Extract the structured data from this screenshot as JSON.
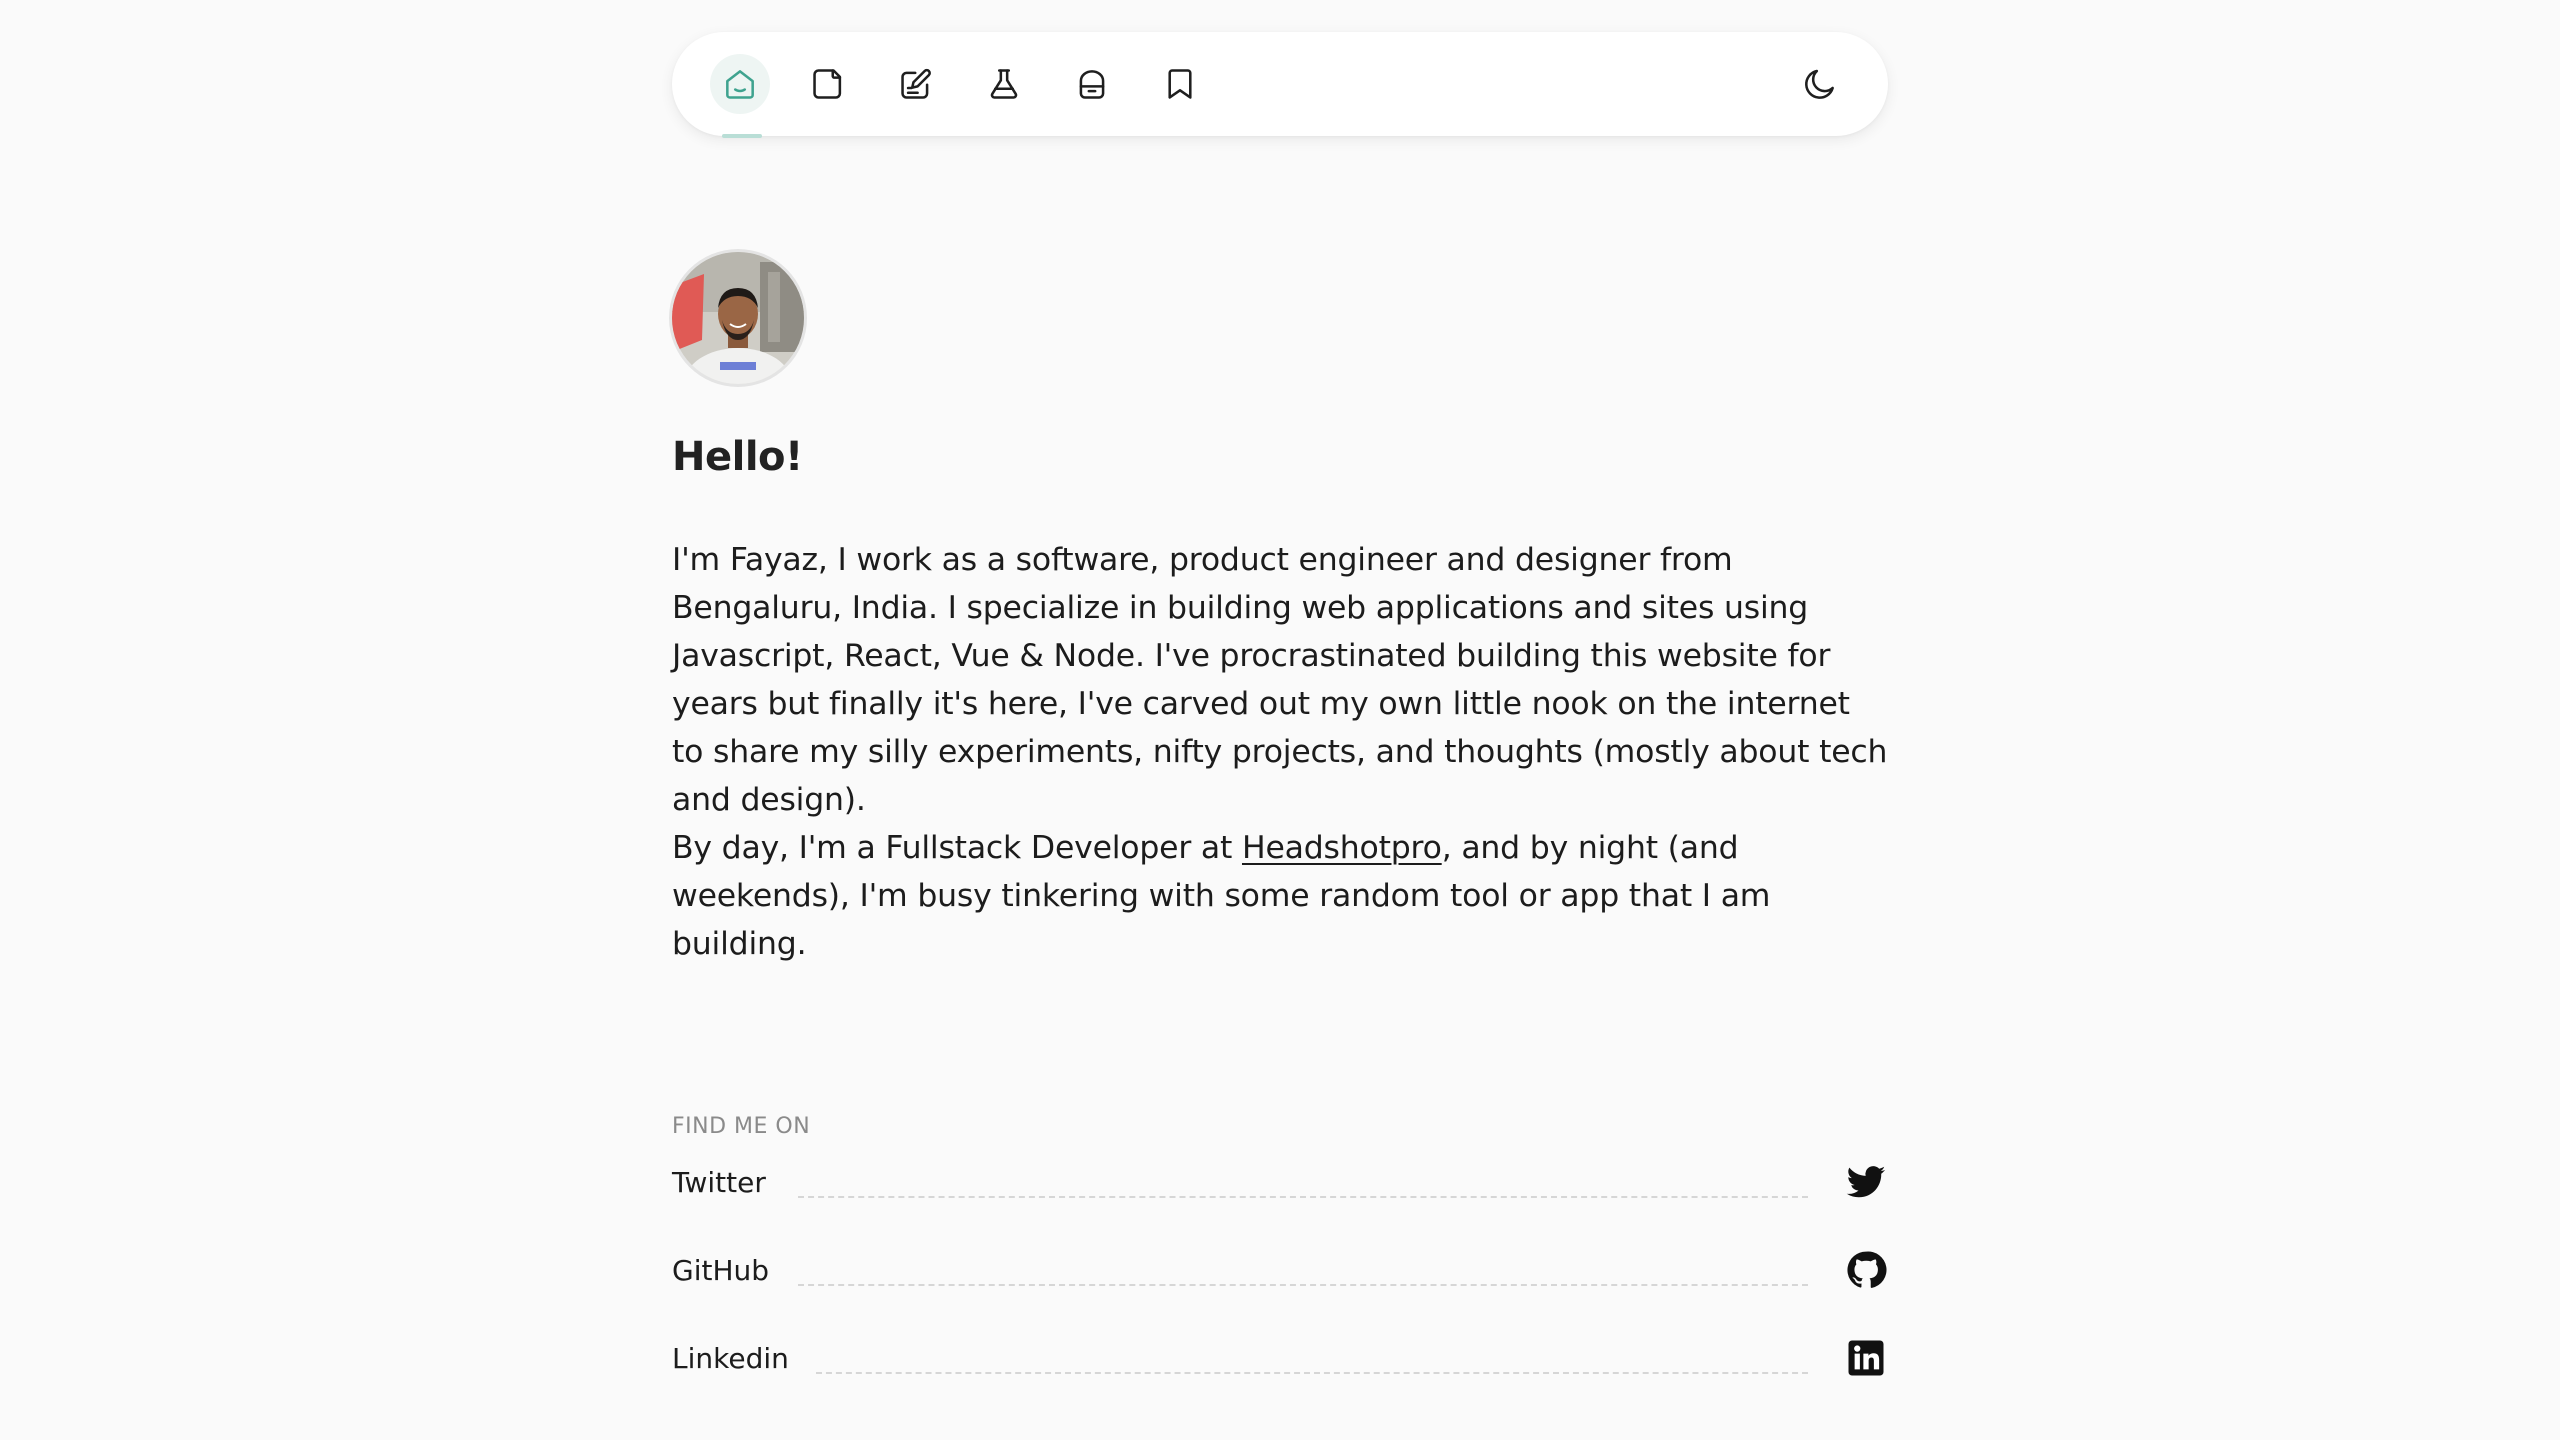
{
  "nav": {
    "items": [
      {
        "icon": "home-icon",
        "active": true
      },
      {
        "icon": "notes-icon",
        "active": false
      },
      {
        "icon": "edit-icon",
        "active": false
      },
      {
        "icon": "flask-icon",
        "active": false
      },
      {
        "icon": "bag-icon",
        "active": false
      },
      {
        "icon": "bookmark-icon",
        "active": false
      }
    ],
    "theme_toggle_icon": "moon-icon",
    "accent_color": "#3fa38f"
  },
  "profile": {
    "greeting": "Hello!",
    "intro": "I'm Fayaz, I work as a software, product engineer and designer from Bengaluru, India. I specialize in building web applications and sites using Javascript, React, Vue & Node. I've procrastinated building this website for years but finally it's here, I've carved out my own little nook on the internet to share my silly experiments, nifty projects, and thoughts (mostly about tech and design).",
    "work_prefix": "By day, I'm a Fullstack Developer at ",
    "work_link": "Headshotpro",
    "work_suffix": ", and by night (and weekends), I'm busy tinkering with some random tool or app that I am building."
  },
  "social": {
    "heading": "FIND ME ON",
    "links": [
      {
        "label": "Twitter",
        "icon": "twitter-icon"
      },
      {
        "label": "GitHub",
        "icon": "github-icon"
      },
      {
        "label": "Linkedin",
        "icon": "linkedin-icon"
      }
    ]
  }
}
